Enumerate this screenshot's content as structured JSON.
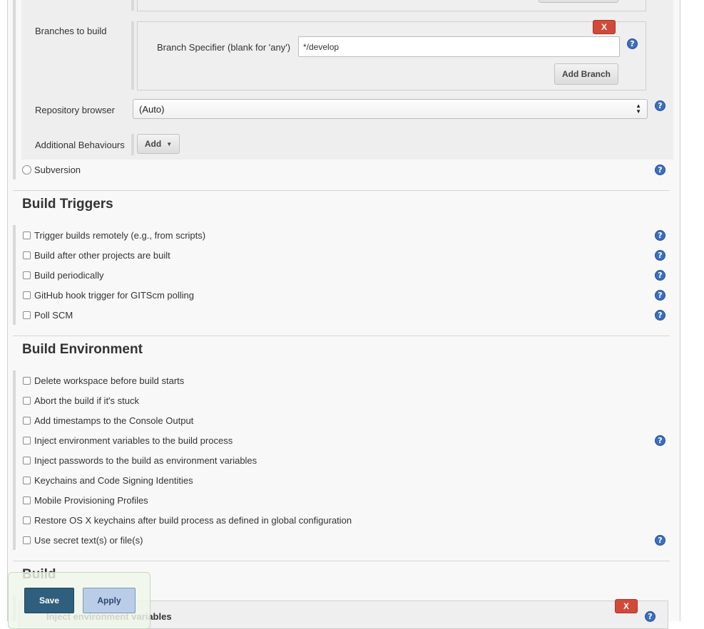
{
  "git": {
    "branches_label": "Branches to build",
    "delete_label": "X",
    "branch_specifier_label": "Branch Specifier (blank for 'any')",
    "branch_specifier_value": "*/develop",
    "add_branch_label": "Add Branch",
    "repo_browser_label": "Repository browser",
    "repo_browser_value": "(Auto)",
    "additional_behaviours_label": "Additional Behaviours",
    "add_label": "Add"
  },
  "scm_options": [
    {
      "label": "Subversion",
      "selected": false
    }
  ],
  "build_triggers": {
    "title": "Build Triggers",
    "items": [
      {
        "label": "Trigger builds remotely (e.g., from scripts)",
        "checked": false,
        "help": true
      },
      {
        "label": "Build after other projects are built",
        "checked": false,
        "help": true
      },
      {
        "label": "Build periodically",
        "checked": false,
        "help": true
      },
      {
        "label": "GitHub hook trigger for GITScm polling",
        "checked": false,
        "help": true
      },
      {
        "label": "Poll SCM",
        "checked": false,
        "help": true
      }
    ]
  },
  "build_environment": {
    "title": "Build Environment",
    "items": [
      {
        "label": "Delete workspace before build starts",
        "checked": false,
        "help": false
      },
      {
        "label": "Abort the build if it's stuck",
        "checked": false,
        "help": false
      },
      {
        "label": "Add timestamps to the Console Output",
        "checked": false,
        "help": false
      },
      {
        "label": "Inject environment variables to the build process",
        "checked": false,
        "help": true
      },
      {
        "label": "Inject passwords to the build as environment variables",
        "checked": false,
        "help": false
      },
      {
        "label": "Keychains and Code Signing Identities",
        "checked": false,
        "help": false
      },
      {
        "label": "Mobile Provisioning Profiles",
        "checked": false,
        "help": false
      },
      {
        "label": "Restore OS X keychains after build process as defined in global configuration",
        "checked": false,
        "help": false
      },
      {
        "label": "Use secret text(s) or file(s)",
        "checked": false,
        "help": true
      }
    ]
  },
  "build": {
    "title": "Build",
    "step_title": "Inject environment variables",
    "delete_label": "X"
  },
  "footer": {
    "save_label": "Save",
    "apply_label": "Apply"
  },
  "icons": {
    "help": "help-icon",
    "dropdown": "caret-down-icon",
    "select": "select-arrows-icon"
  },
  "colors": {
    "delete_red": "#d24939",
    "help_blue": "#3a6fc1",
    "save_blue": "#2f5f7d",
    "apply_blue": "#b9cde8"
  }
}
